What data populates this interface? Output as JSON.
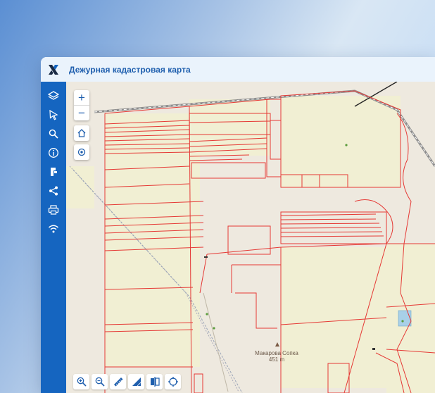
{
  "app": {
    "title": "Дежурная кадастровая карта"
  },
  "sidebar": {
    "items": [
      {
        "icon": "layers-icon",
        "label": "Слои"
      },
      {
        "icon": "cursor-icon",
        "label": "Выбор"
      },
      {
        "icon": "search-icon",
        "label": "Поиск"
      },
      {
        "icon": "info-icon",
        "label": "Информация"
      },
      {
        "icon": "fragment-icon",
        "label": "Фрагмент"
      },
      {
        "icon": "share-icon",
        "label": "Поделиться"
      },
      {
        "icon": "print-icon",
        "label": "Печать"
      },
      {
        "icon": "wifi-icon",
        "label": "Онлайн"
      }
    ]
  },
  "map": {
    "zoom_in": "+",
    "zoom_out": "−",
    "place": {
      "name": "Макарова Сопка",
      "elevation": "451 m"
    }
  },
  "colors": {
    "accent": "#1565c0",
    "parcel_border": "#e53935",
    "map_bg": "#eee9df",
    "field": "#f2efd6"
  },
  "toolbar": {
    "tools": [
      "zoom-in-area-icon",
      "zoom-out-area-icon",
      "ruler-icon",
      "area-measure-icon",
      "compare-icon",
      "crosshair-icon"
    ]
  }
}
